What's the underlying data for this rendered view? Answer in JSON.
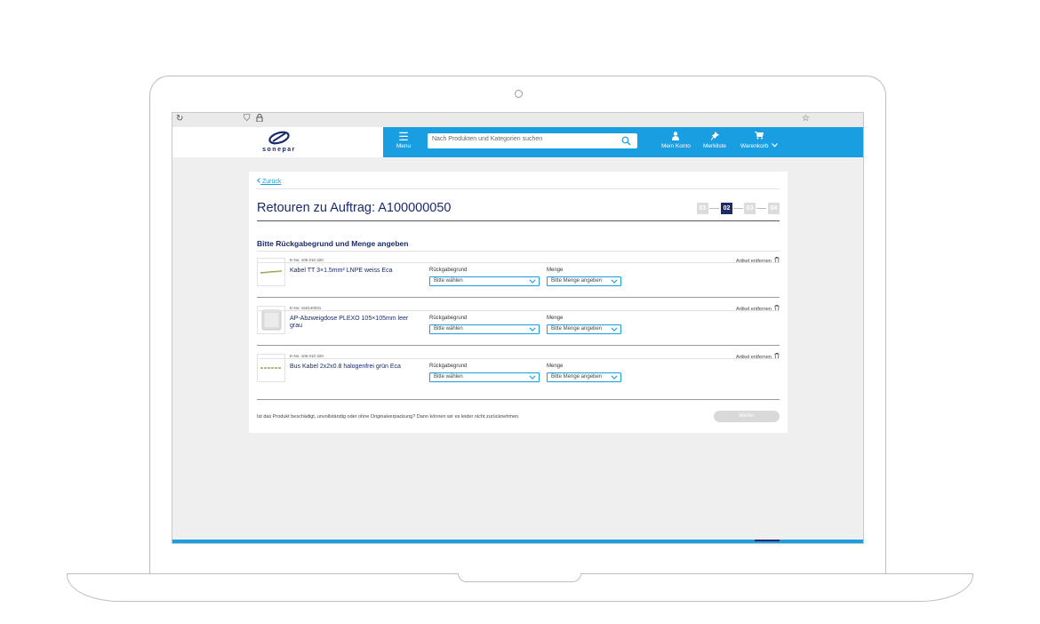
{
  "header": {
    "logo_text": "sonepar",
    "menu_label": "Menu",
    "search_placeholder": "Nach Produkten und Kategorien suchen",
    "account_label": "Mein Konto",
    "wishlist_label": "Merkliste",
    "cart_label": "Warenkorb"
  },
  "page": {
    "back_label": "Zurück",
    "title": "Retouren zu Auftrag: A100000050",
    "steps": [
      "01",
      "02",
      "03",
      "04"
    ],
    "active_step": "02",
    "section_title": "Bitte Rückgabegrund und Menge angeben"
  },
  "items": [
    {
      "enr": "E-No: 106 010 320",
      "name": "Kabel TT 3×1.5mm² LNPE weiss Eca",
      "reason_label": "Rückgabegrund",
      "reason_value": "Bitte wählen",
      "qty_label": "Menge",
      "qty_value": "Bitte Menge angeben",
      "remove_label": "Artikel entfernen"
    },
    {
      "enr": "E-No: 152140031",
      "name": "AP-Abzweigdose PLEXO 105×105mm leer grau",
      "reason_label": "Rückgabegrund",
      "reason_value": "Bitte wählen",
      "qty_label": "Menge",
      "qty_value": "Bitte Menge angeben",
      "remove_label": "Artikel entfernen"
    },
    {
      "enr": "E-No: 106 010 320",
      "name": "Bus Kabel 2x2x0.8 halogenfrei grün Eca",
      "reason_label": "Rückgabegrund",
      "reason_value": "Bitte wählen",
      "qty_label": "Menge",
      "qty_value": "Bitte Menge angeben",
      "remove_label": "Artikel entfernen"
    }
  ],
  "footer": {
    "note": "Ist das Produkt beschädigt, unvollständig oder ohne Originalverpackung? Dann können wir es leider nicht zurücknehmen.",
    "next_button": "Weiter"
  },
  "colors": {
    "brand_blue": "#1a9ee2",
    "brand_navy": "#1b2a6b",
    "disabled_grey": "#d9d9d9"
  }
}
